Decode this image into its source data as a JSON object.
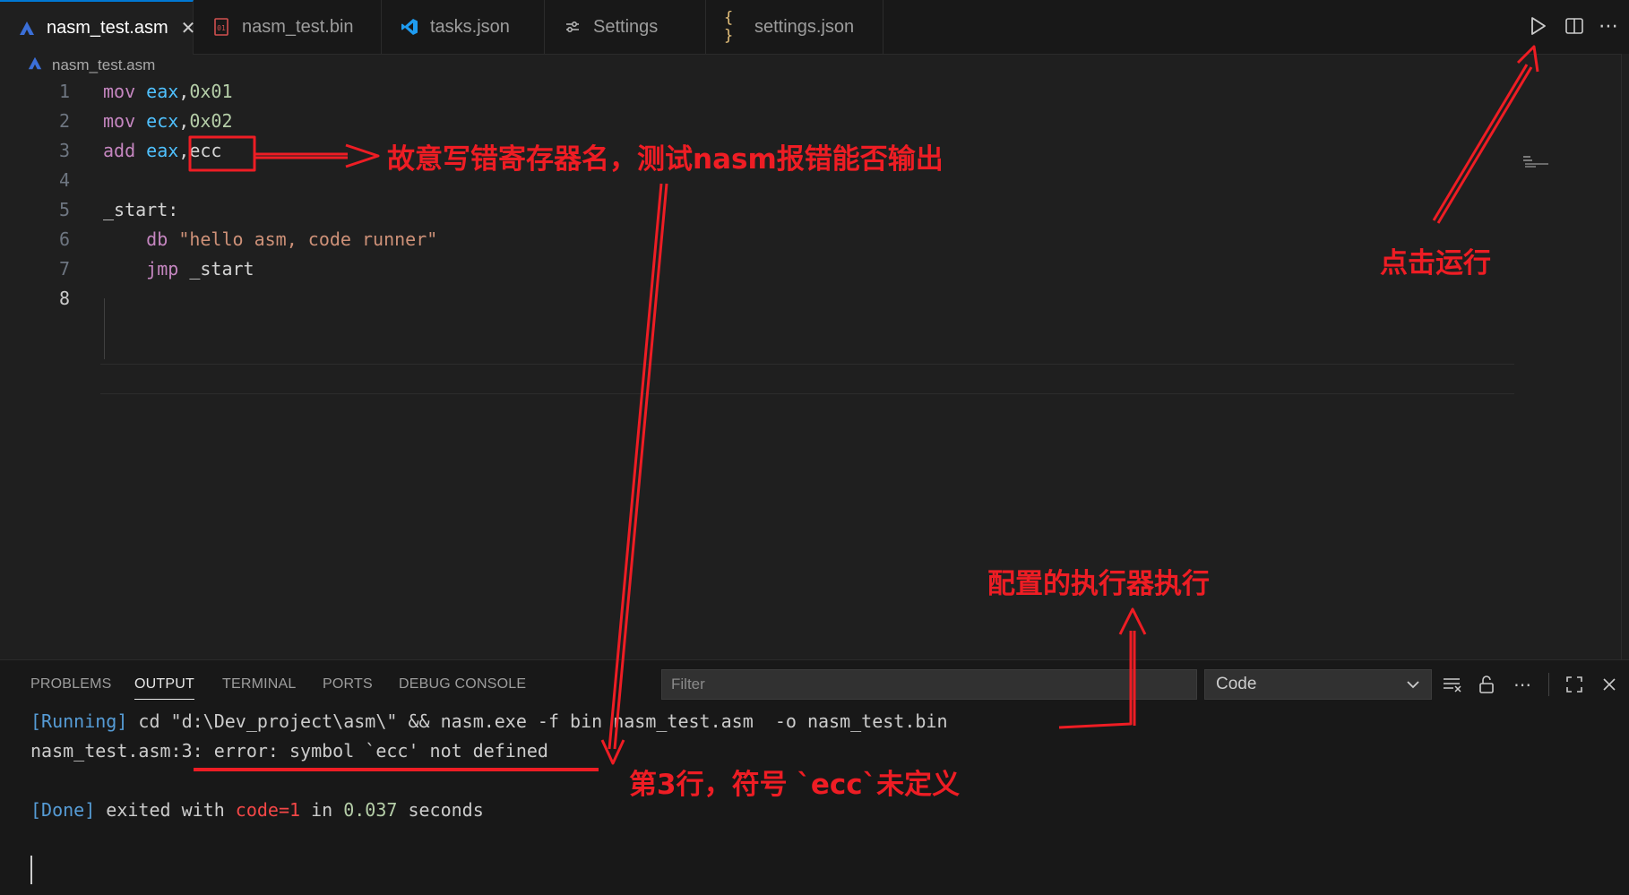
{
  "tabs": [
    {
      "label": "nasm_test.asm",
      "icon": "asm-file-icon",
      "active": true,
      "close": "✕"
    },
    {
      "label": "nasm_test.bin",
      "icon": "binary-file-icon",
      "active": false
    },
    {
      "label": "tasks.json",
      "icon": "vscode-icon",
      "active": false
    },
    {
      "label": "Settings",
      "icon": "settings-sliders-icon",
      "active": false
    },
    {
      "label": "settings.json",
      "icon": "json-braces-icon",
      "active": false
    }
  ],
  "breadcrumb": {
    "file": "nasm_test.asm"
  },
  "editor": {
    "line_numbers": [
      "1",
      "2",
      "3",
      "4",
      "5",
      "6",
      "7",
      "8"
    ],
    "current_line": "8"
  },
  "code": {
    "l1": {
      "op": "mov",
      "reg": "eax",
      "comma": ",",
      "num": "0x01"
    },
    "l2": {
      "op": "mov",
      "reg": "ecx",
      "comma": ",",
      "num": "0x02"
    },
    "l3": {
      "op": "add",
      "reg": "eax",
      "comma": ",",
      "bad": "ecc"
    },
    "l5": {
      "label": "_start:"
    },
    "l6": {
      "op": "db",
      "str": "\"hello asm, code runner\""
    },
    "l7": {
      "op": "jmp",
      "target": "_start"
    }
  },
  "panel": {
    "tabs": [
      "PROBLEMS",
      "OUTPUT",
      "TERMINAL",
      "PORTS",
      "DEBUG CONSOLE"
    ],
    "active_tab": "OUTPUT",
    "filter_placeholder": "Filter",
    "channel": "Code",
    "output": {
      "l1_tag": "[Running]",
      "l1_cmd": " cd \"d:\\Dev_project\\asm\\\" && nasm.exe -f bin nasm_test.asm  -o nasm_test.bin",
      "l2_file": "nasm_test.asm:",
      "l2_err": "3: error: symbol `ecc' not defined",
      "l4_tag": "[Done]",
      "l4_a": " exited with ",
      "l4_code": "code=1",
      "l4_b": " in ",
      "l4_time": "0.037",
      "l4_c": " seconds"
    }
  },
  "annotations": {
    "register_note": "故意写错寄存器名，测试nasm报错能否输出",
    "run_note": "点击运行",
    "runner_note": "配置的执行器执行",
    "error_note": "第3行，符号 `ecc`未定义"
  },
  "colors": {
    "accent": "#0078d4",
    "annotation": "#ee1d24"
  }
}
